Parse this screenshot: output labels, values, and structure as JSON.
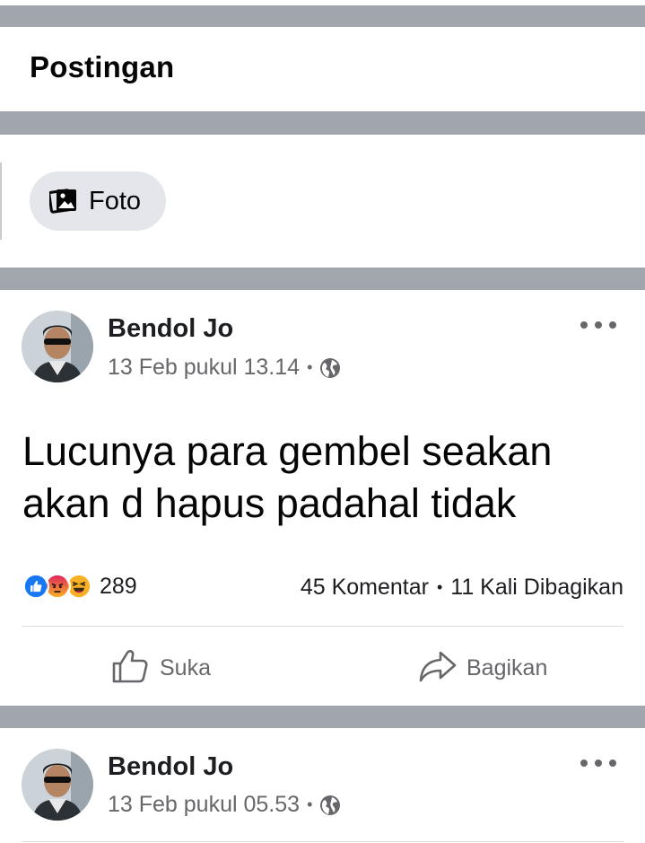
{
  "page": {
    "title": "Postingan"
  },
  "filter": {
    "foto_label": "Foto"
  },
  "posts": [
    {
      "author": "Bendol Jo",
      "timestamp": "13 Feb pukul 13.14",
      "separator": "•",
      "text": "Lucunya para gembel seakan akan d hapus padahal tidak",
      "reaction_count": "289",
      "reactions": [
        "like",
        "angry",
        "haha"
      ],
      "comments": "45 Komentar",
      "shares": "11 Kali Dibagikan",
      "like_label": "Suka",
      "share_label": "Bagikan"
    },
    {
      "author": "Bendol Jo",
      "timestamp": "13 Feb pukul 05.53",
      "separator": "•"
    }
  ],
  "colors": {
    "divider": "#a1a5ac",
    "chip": "#e4e6eb",
    "like": "#1877f2",
    "angry": "#e9710f",
    "haha": "#f7b125",
    "secondary_text": "#65676b"
  }
}
